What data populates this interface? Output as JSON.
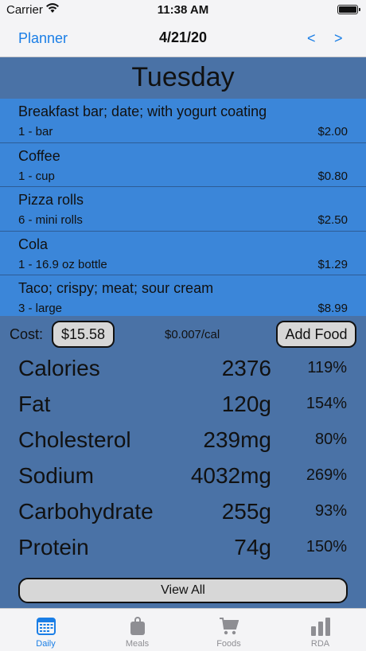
{
  "status": {
    "carrier": "Carrier",
    "time": "11:38 AM"
  },
  "nav": {
    "planner": "Planner",
    "date": "4/21/20",
    "prev": "<",
    "next": ">"
  },
  "day": "Tuesday",
  "foods": [
    {
      "name": "Breakfast bar; date; with yogurt coating",
      "qty": "1 - bar",
      "price": "$2.00"
    },
    {
      "name": "Coffee",
      "qty": "1 - cup",
      "price": "$0.80"
    },
    {
      "name": "Pizza rolls",
      "qty": "6 - mini rolls",
      "price": "$2.50"
    },
    {
      "name": "Cola",
      "qty": "1 - 16.9 oz bottle",
      "price": "$1.29"
    },
    {
      "name": "Taco; crispy; meat; sour cream",
      "qty": "3 - large",
      "price": "$8.99"
    }
  ],
  "cost": {
    "label": "Cost:",
    "total": "$15.58",
    "per_cal": "$0.007/cal",
    "add_food": "Add Food"
  },
  "nutrients": [
    {
      "name": "Calories",
      "amount": "2376",
      "pct": "119%"
    },
    {
      "name": "Fat",
      "amount": "120g",
      "pct": "154%"
    },
    {
      "name": "Cholesterol",
      "amount": "239mg",
      "pct": "80%"
    },
    {
      "name": "Sodium",
      "amount": "4032mg",
      "pct": "269%"
    },
    {
      "name": "Carbohydrate",
      "amount": "255g",
      "pct": "93%"
    },
    {
      "name": "Protein",
      "amount": "74g",
      "pct": "150%"
    }
  ],
  "view_all": "View All",
  "tabs": [
    {
      "label": "Daily",
      "icon": "calendar-icon",
      "active": true
    },
    {
      "label": "Meals",
      "icon": "bag-icon",
      "active": false
    },
    {
      "label": "Foods",
      "icon": "cart-icon",
      "active": false
    },
    {
      "label": "RDA",
      "icon": "bar-chart-icon",
      "active": false
    }
  ],
  "colors": {
    "accent": "#1a7ee6",
    "list_bg": "#3b86d9",
    "page_bg": "#4a72a6"
  }
}
